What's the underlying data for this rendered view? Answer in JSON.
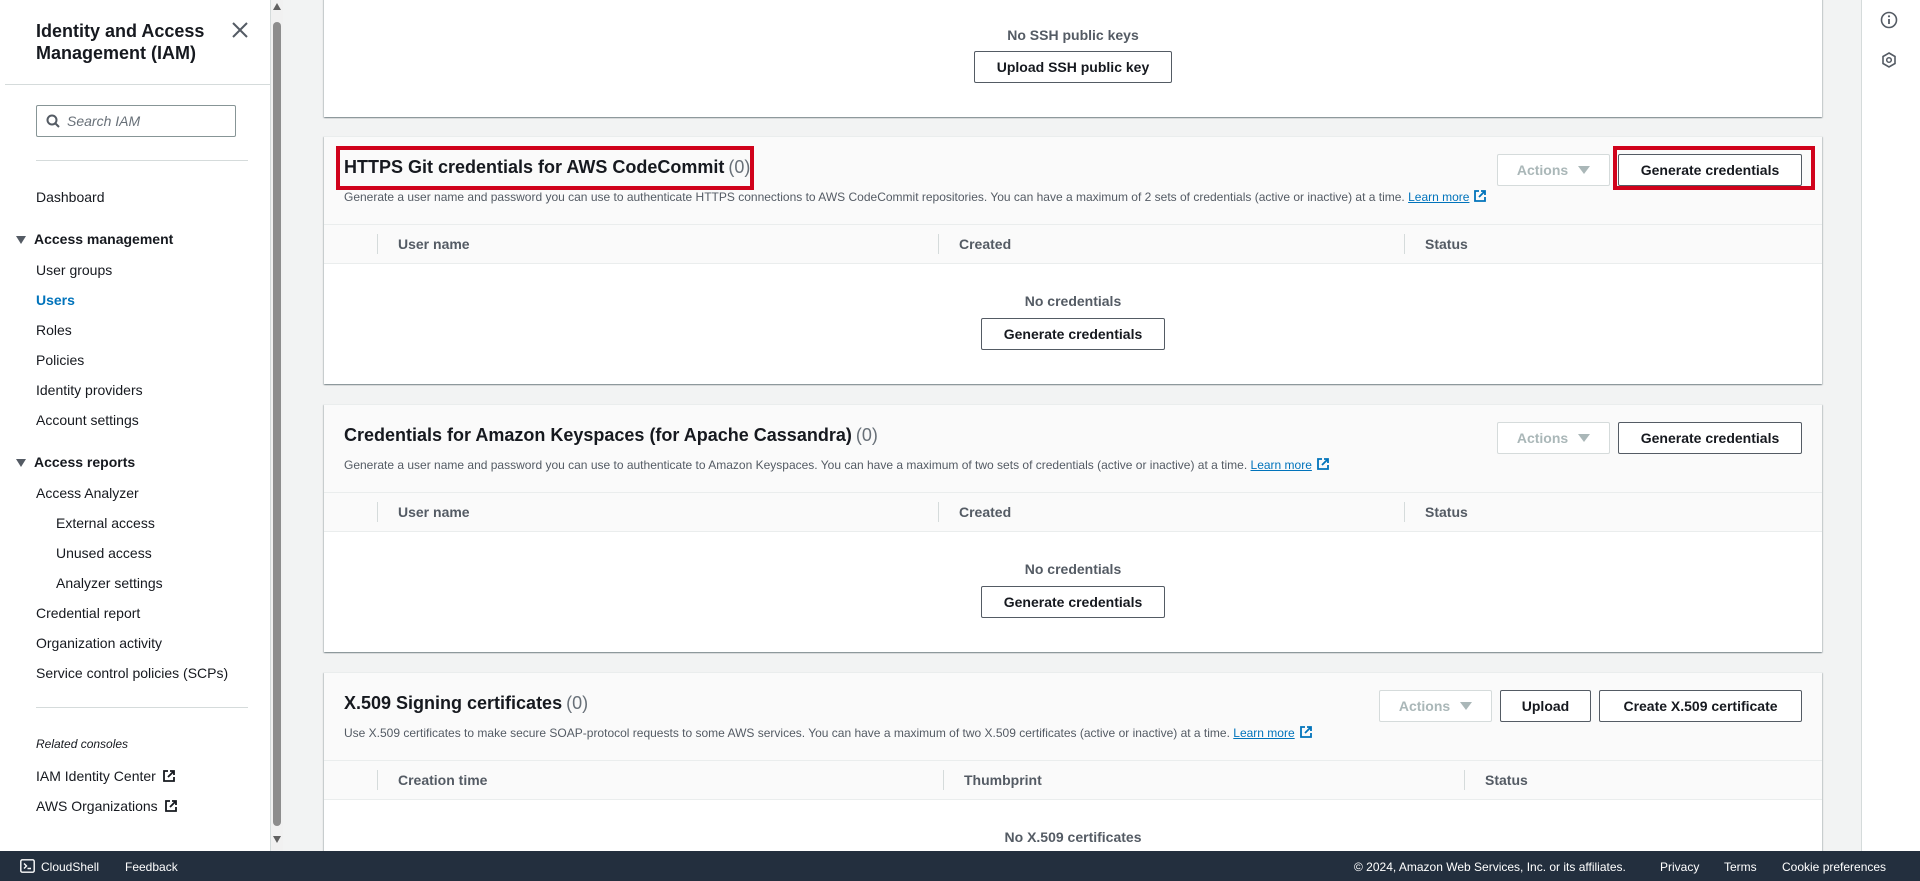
{
  "sidebar": {
    "title": "Identity and Access Management (IAM)",
    "search_placeholder": "Search IAM",
    "dashboard": "Dashboard",
    "access_management": {
      "label": "Access management",
      "items": [
        "User groups",
        "Users",
        "Roles",
        "Policies",
        "Identity providers",
        "Account settings"
      ],
      "active": "Users"
    },
    "access_reports": {
      "label": "Access reports",
      "analyzer": "Access Analyzer",
      "analyzer_items": [
        "External access",
        "Unused access",
        "Analyzer settings"
      ],
      "items": [
        "Credential report",
        "Organization activity",
        "Service control policies (SCPs)"
      ]
    },
    "related_heading": "Related consoles",
    "related": [
      "IAM Identity Center",
      "AWS Organizations"
    ]
  },
  "ssh": {
    "empty_text": "No SSH public keys",
    "upload_button": "Upload SSH public key"
  },
  "codecommit": {
    "title": "HTTPS Git credentials for AWS CodeCommit",
    "count": "(0)",
    "description": "Generate a user name and password you can use to authenticate HTTPS connections to AWS CodeCommit repositories. You can have a maximum of 2 sets of credentials (active or inactive) at a time.",
    "learn_more": "Learn more",
    "actions_label": "Actions",
    "generate_button": "Generate credentials",
    "columns": [
      "User name",
      "Created",
      "Status"
    ],
    "empty_text": "No credentials",
    "empty_button": "Generate credentials"
  },
  "keyspaces": {
    "title": "Credentials for Amazon Keyspaces (for Apache Cassandra)",
    "count": "(0)",
    "description": "Generate a user name and password you can use to authenticate to Amazon Keyspaces. You can have a maximum of two sets of credentials (active or inactive) at a time.",
    "learn_more": "Learn more",
    "actions_label": "Actions",
    "generate_button": "Generate credentials",
    "columns": [
      "User name",
      "Created",
      "Status"
    ],
    "empty_text": "No credentials",
    "empty_button": "Generate credentials"
  },
  "x509": {
    "title": "X.509 Signing certificates",
    "count": "(0)",
    "description": "Use X.509 certificates to make secure SOAP-protocol requests to some AWS services. You can have a maximum of two X.509 certificates (active or inactive) at a time.",
    "learn_more": "Learn more",
    "actions_label": "Actions",
    "upload_button": "Upload",
    "create_button": "Create X.509 certificate",
    "columns": [
      "Creation time",
      "Thumbprint",
      "Status"
    ],
    "empty_text": "No X.509 certificates"
  },
  "footer": {
    "cloudshell": "CloudShell",
    "feedback": "Feedback",
    "copyright": "© 2024, Amazon Web Services, Inc. or its affiliates.",
    "privacy": "Privacy",
    "terms": "Terms",
    "cookies": "Cookie preferences"
  },
  "colors": {
    "link": "#0073bb",
    "highlight": "#d0021b",
    "footer_bg": "#232f3e"
  },
  "icons": [
    "close-icon",
    "search-icon",
    "caret-down-icon",
    "external-link-icon",
    "info-icon",
    "settings-hexagon-icon",
    "cloudshell-icon"
  ]
}
